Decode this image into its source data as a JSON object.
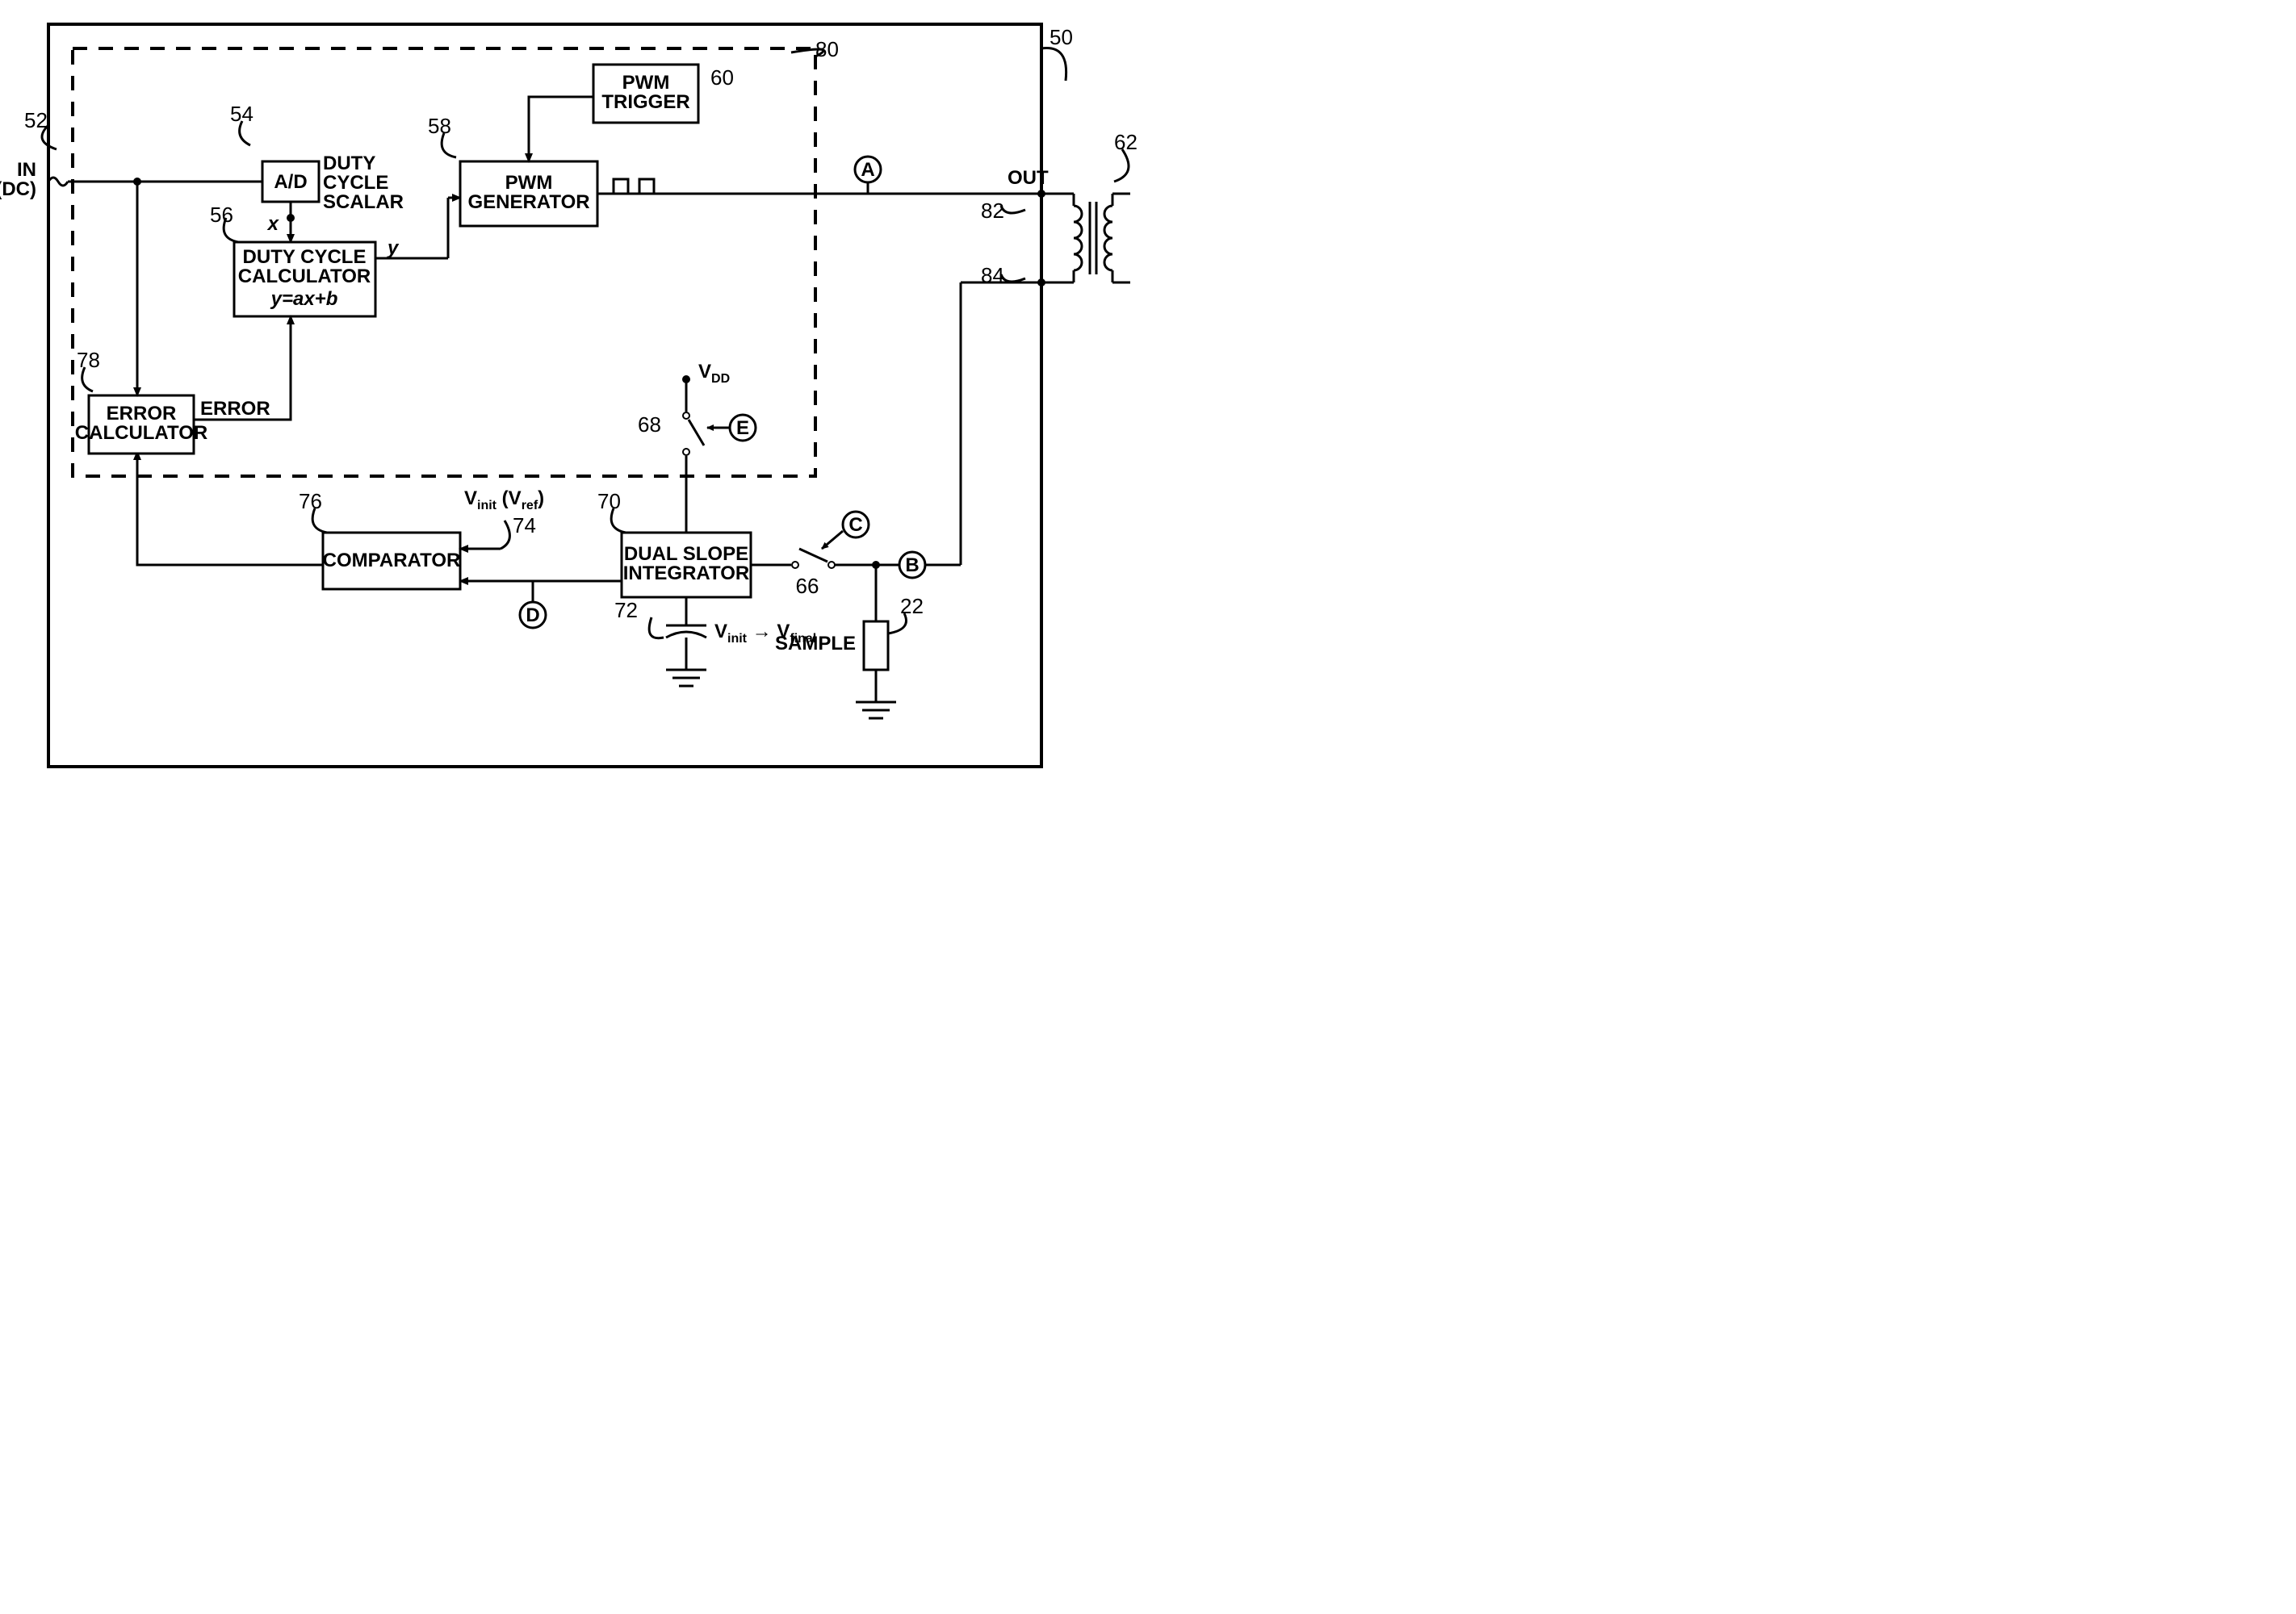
{
  "refs": {
    "n50": "50",
    "n52": "52",
    "n54": "54",
    "n56": "56",
    "n58": "58",
    "n60": "60",
    "n62": "62",
    "n66": "66",
    "n68": "68",
    "n70": "70",
    "n72": "72",
    "n74": "74",
    "n76": "76",
    "n78": "78",
    "n80": "80",
    "n82": "82",
    "n84": "84",
    "n22": "22"
  },
  "blocks": {
    "ad": "A/D",
    "duty_calc_l1": "DUTY CYCLE",
    "duty_calc_l2": "CALCULATOR",
    "duty_calc_eq": "y=ax+b",
    "pwm_gen_l1": "PWM",
    "pwm_gen_l2": "GENERATOR",
    "pwm_trig_l1": "PWM",
    "pwm_trig_l2": "TRIGGER",
    "error_calc_l1": "ERROR",
    "error_calc_l2": "CALCULATOR",
    "comparator": "COMPARATOR",
    "dsi_l1": "DUAL SLOPE",
    "dsi_l2": "INTEGRATOR",
    "sample": "SAMPLE"
  },
  "labels": {
    "in_l1": "IN",
    "in_l2": "(DC)",
    "out": "OUT",
    "duty_cycle_scalar_l1": "DUTY",
    "duty_cycle_scalar_l2": "CYCLE",
    "duty_cycle_scalar_l3": "SCALAR",
    "x": "x",
    "y": "y",
    "error": "ERROR",
    "vdd": "V",
    "vdd_sub": "DD",
    "vinit_ref": "V",
    "vinit_ref_sub1": "init",
    "vinit_ref_r": " (V",
    "vinit_ref_sub2": "ref",
    "vinit_ref_close": ")",
    "vinit_final": "V",
    "vinit_final_s1": "init",
    "vinit_final_arrow": " → V",
    "vinit_final_s2": "final"
  },
  "nodes": {
    "A": "A",
    "B": "B",
    "C": "C",
    "D": "D",
    "E": "E"
  }
}
